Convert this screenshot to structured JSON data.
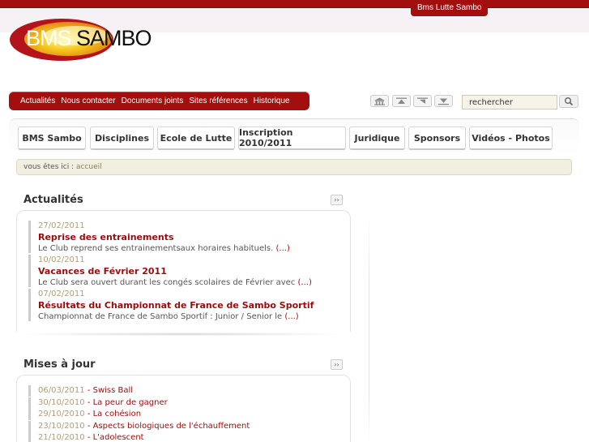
{
  "header": {
    "top_tab": "Bms Lutte Sambo",
    "logo_part1": "BMS",
    "logo_part2": "SAMBO"
  },
  "main_nav": [
    "Actualités",
    "Nous contacter",
    "Documents joints",
    "Sites références",
    "Historique"
  ],
  "tool_icons": [
    "home-icon",
    "arrow-up-icon",
    "arrow-up-right-icon",
    "arrow-down-icon"
  ],
  "search": {
    "value": "rechercher",
    "button_icon": "magnifier-icon"
  },
  "tabs": [
    "BMS Sambo",
    "Disciplines",
    "Ecole de Lutte",
    "Inscription 2010/2011",
    "Juridique",
    "Sponsors",
    "Vidéos - Photos"
  ],
  "breadcrumb": {
    "label": "vous êtes ici :",
    "current": "accueil"
  },
  "actualites": {
    "title": "Actualités",
    "more": "››",
    "items": [
      {
        "date": "27/02/2011",
        "title": "Reprise des entrainements",
        "desc": "Le Club reprend ses entrainementsaux horaires habituels.",
        "more": "(...)"
      },
      {
        "date": "10/02/2011",
        "title": "Vacances de Février 2011",
        "desc": "Le Club sera ouvert durant les congés scolaires de Février avec",
        "more": "(...)"
      },
      {
        "date": "07/02/2011",
        "title": "Résultats du Championnat de France de Sambo Sportif",
        "desc": "Championnat de France de Sambo Sportif : Junior / Senior le",
        "more": "(...)"
      }
    ]
  },
  "mises_a_jour": {
    "title": "Mises à jour",
    "more": "››",
    "items": [
      {
        "date": "06/03/2011",
        "title": "Swiss Ball"
      },
      {
        "date": "30/10/2010",
        "title": "La peur de gagner"
      },
      {
        "date": "29/10/2010",
        "title": "La cohésion"
      },
      {
        "date": "23/10/2010",
        "title": "Aspects biologiques de l'échauffement"
      },
      {
        "date": "21/10/2010",
        "title": "L'adolescent"
      }
    ]
  },
  "colors": {
    "brand_red": "#a30f0f",
    "link_red": "#9c0b0b",
    "date_tan": "#b09f78"
  }
}
